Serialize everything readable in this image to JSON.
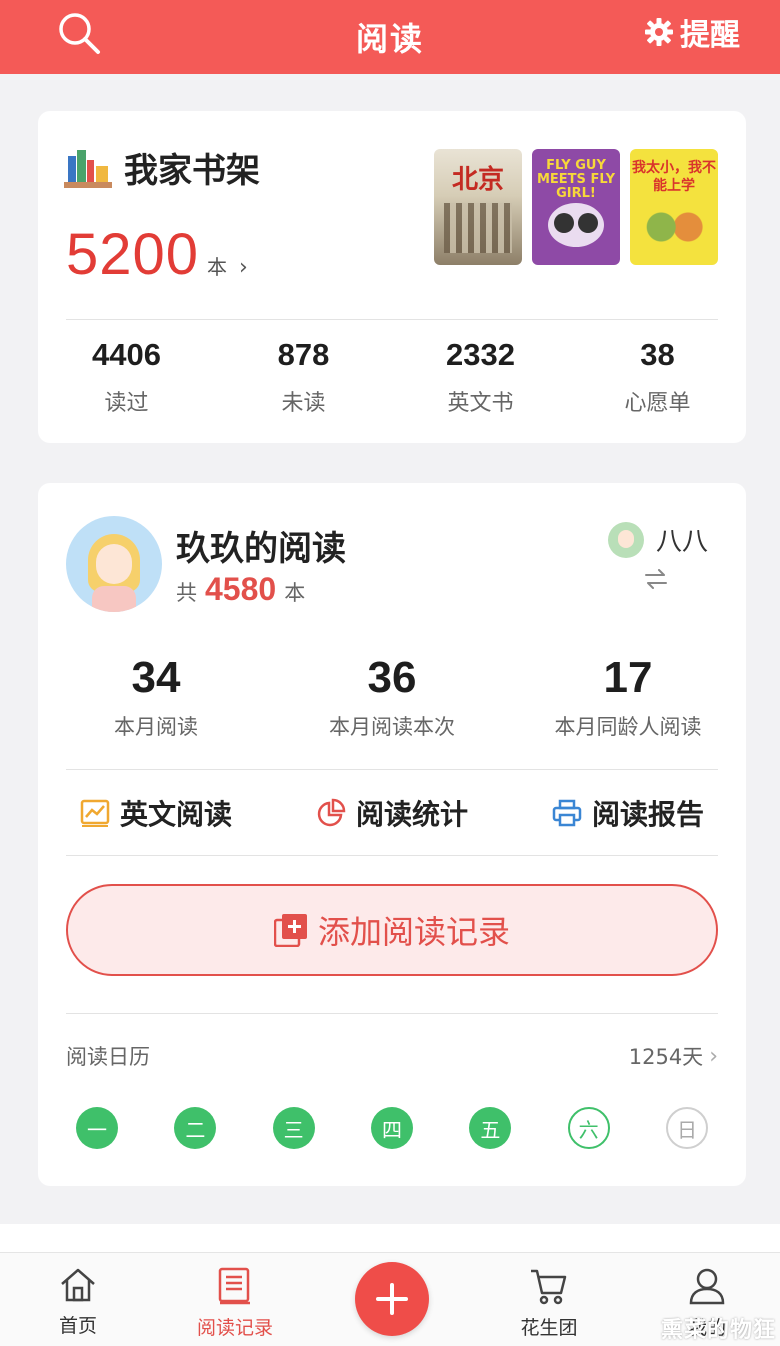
{
  "header": {
    "title": "阅读",
    "remind_label": "提醒"
  },
  "bookshelf": {
    "title": "我家书架",
    "count": "5200",
    "unit": "本",
    "chevron": "›",
    "covers": [
      {
        "text": "北京"
      },
      {
        "text": "FLY GUY MEETS FLY GIRL!"
      },
      {
        "text": "我太小，我不能上学"
      }
    ],
    "stats": [
      {
        "value": "4406",
        "label": "读过"
      },
      {
        "value": "878",
        "label": "未读"
      },
      {
        "value": "2332",
        "label": "英文书"
      },
      {
        "value": "38",
        "label": "心愿单"
      }
    ]
  },
  "child": {
    "name": "玖玖的阅读",
    "total_prefix": "共",
    "total": "4580",
    "total_unit": "本",
    "other_user": "八八",
    "stats": [
      {
        "value": "34",
        "label": "本月阅读"
      },
      {
        "value": "36",
        "label": "本月阅读本次"
      },
      {
        "value": "17",
        "label": "本月同龄人阅读"
      }
    ],
    "actions": [
      {
        "label": "英文阅读",
        "icon": "chart-line-icon"
      },
      {
        "label": "阅读统计",
        "icon": "pie-chart-icon"
      },
      {
        "label": "阅读报告",
        "icon": "printer-icon"
      }
    ],
    "add_record_label": "添加阅读记录",
    "calendar": {
      "title": "阅读日历",
      "days_count": "1254天",
      "chevron": "›",
      "week": [
        {
          "label": "一",
          "state": "done"
        },
        {
          "label": "二",
          "state": "done"
        },
        {
          "label": "三",
          "state": "done"
        },
        {
          "label": "四",
          "state": "done"
        },
        {
          "label": "五",
          "state": "done"
        },
        {
          "label": "六",
          "state": "today"
        },
        {
          "label": "日",
          "state": "future"
        }
      ]
    }
  },
  "tabbar": {
    "home": "首页",
    "record": "阅读记录",
    "group": "花生团",
    "mine": "我的"
  },
  "colors": {
    "brand": "#f45a57",
    "accent_red": "#e2504b",
    "calendar_green": "#3fc06a"
  },
  "watermark": "熏菜的物狂"
}
